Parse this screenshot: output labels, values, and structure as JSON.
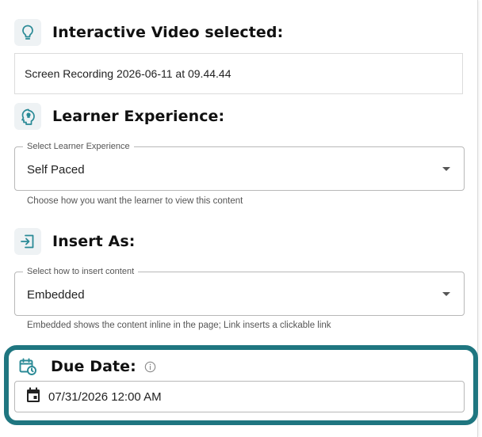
{
  "selected_content": {
    "title": "Interactive Video selected:",
    "icon": "lightbulb-icon",
    "value": "Screen Recording 2026-06-11 at 09.44.44"
  },
  "learner_experience": {
    "title": "Learner Experience:",
    "icon": "head-lightbulb-icon",
    "legend": "Select Learner Experience",
    "value": "Self Paced",
    "helper": "Choose how you want the learner to view this content"
  },
  "insert_as": {
    "title": "Insert As:",
    "icon": "insert-arrow-icon",
    "legend": "Select how to insert content",
    "value": "Embedded",
    "helper": "Embedded shows the content inline in the page; Link inserts a clickable link"
  },
  "due_date": {
    "title": "Due Date:",
    "icon": "calendar-clock-icon",
    "info_icon": "info-icon",
    "value": "07/31/2026 12:00 AM",
    "input_icon": "calendar-icon"
  },
  "colors": {
    "accent": "#2a8a96",
    "highlight": "#1f7680",
    "icon_bg": "#eef2f4"
  }
}
